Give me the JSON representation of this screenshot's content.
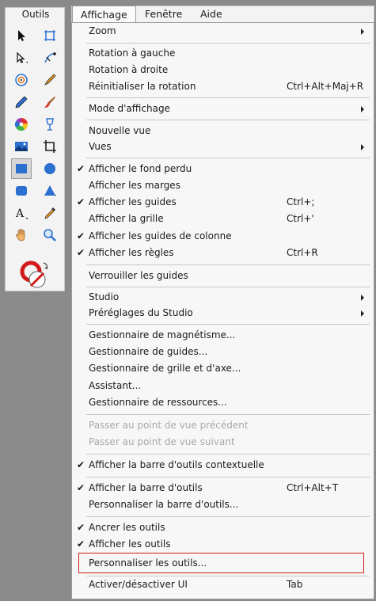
{
  "tools_panel": {
    "title": "Outils",
    "tools": [
      {
        "name": "selection-arrow-icon"
      },
      {
        "name": "frame-selection-icon"
      },
      {
        "name": "direct-selection-icon"
      },
      {
        "name": "curve-pen-icon"
      },
      {
        "name": "target-selection-icon"
      },
      {
        "name": "pen-nib-icon"
      },
      {
        "name": "pencil-icon"
      },
      {
        "name": "brush-icon"
      },
      {
        "name": "color-wheel-icon"
      },
      {
        "name": "goblet-fill-icon"
      },
      {
        "name": "image-placeholder-icon"
      },
      {
        "name": "crop-icon"
      },
      {
        "name": "rectangle-icon"
      },
      {
        "name": "ellipse-icon"
      },
      {
        "name": "rounded-rectangle-icon"
      },
      {
        "name": "triangle-icon"
      },
      {
        "name": "text-tool-icon"
      },
      {
        "name": "color-picker-icon"
      },
      {
        "name": "hand-pan-icon"
      },
      {
        "name": "zoom-magnifier-icon"
      }
    ],
    "accent_color": "#2b6fcf"
  },
  "menubar": {
    "items": [
      "Affichage",
      "Fenêtre",
      "Aide"
    ],
    "open": "Affichage"
  },
  "menu": {
    "items": [
      {
        "label": "Zoom",
        "submenu": true
      },
      {
        "label": "Rotation à gauche"
      },
      {
        "label": "Rotation à droite"
      },
      {
        "label": "Réinitialiser la rotation",
        "shortcut": "Ctrl+Alt+Maj+R"
      },
      {
        "label": "Mode d'affichage",
        "submenu": true
      },
      {
        "label": "Nouvelle vue"
      },
      {
        "label": "Vues",
        "submenu": true
      },
      {
        "label": "Afficher le fond perdu",
        "checked": true
      },
      {
        "label": "Afficher les marges"
      },
      {
        "label": "Afficher les guides",
        "checked": true,
        "shortcut": "Ctrl+;"
      },
      {
        "label": "Afficher la grille",
        "shortcut": "Ctrl+'"
      },
      {
        "label": "Afficher les guides de colonne",
        "checked": true
      },
      {
        "label": "Afficher les règles",
        "checked": true,
        "shortcut": "Ctrl+R"
      },
      {
        "label": "Verrouiller les guides"
      },
      {
        "label": "Studio",
        "submenu": true
      },
      {
        "label": "Préréglages du Studio",
        "submenu": true
      },
      {
        "label": "Gestionnaire de magnétisme..."
      },
      {
        "label": "Gestionnaire de guides..."
      },
      {
        "label": "Gestionnaire de grille et d'axe..."
      },
      {
        "label": "Assistant..."
      },
      {
        "label": "Gestionnaire de ressources..."
      },
      {
        "label": "Passer au point de vue précédent",
        "disabled": true
      },
      {
        "label": "Passer au point de vue suivant",
        "disabled": true
      },
      {
        "label": "Afficher la barre d'outils contextuelle",
        "checked": true
      },
      {
        "label": "Afficher la barre d'outils",
        "checked": true,
        "shortcut": "Ctrl+Alt+T"
      },
      {
        "label": "Personnaliser la barre d'outils..."
      },
      {
        "label": "Ancrer les outils",
        "checked": true
      },
      {
        "label": "Afficher les outils",
        "checked": true
      },
      {
        "label": "Personnaliser les outils...",
        "highlighted": true
      },
      {
        "label": "Activer/désactiver UI",
        "shortcut": "Tab"
      }
    ],
    "check_mark": "✔"
  },
  "colors": {
    "highlight_outline": "#d21a1a"
  }
}
